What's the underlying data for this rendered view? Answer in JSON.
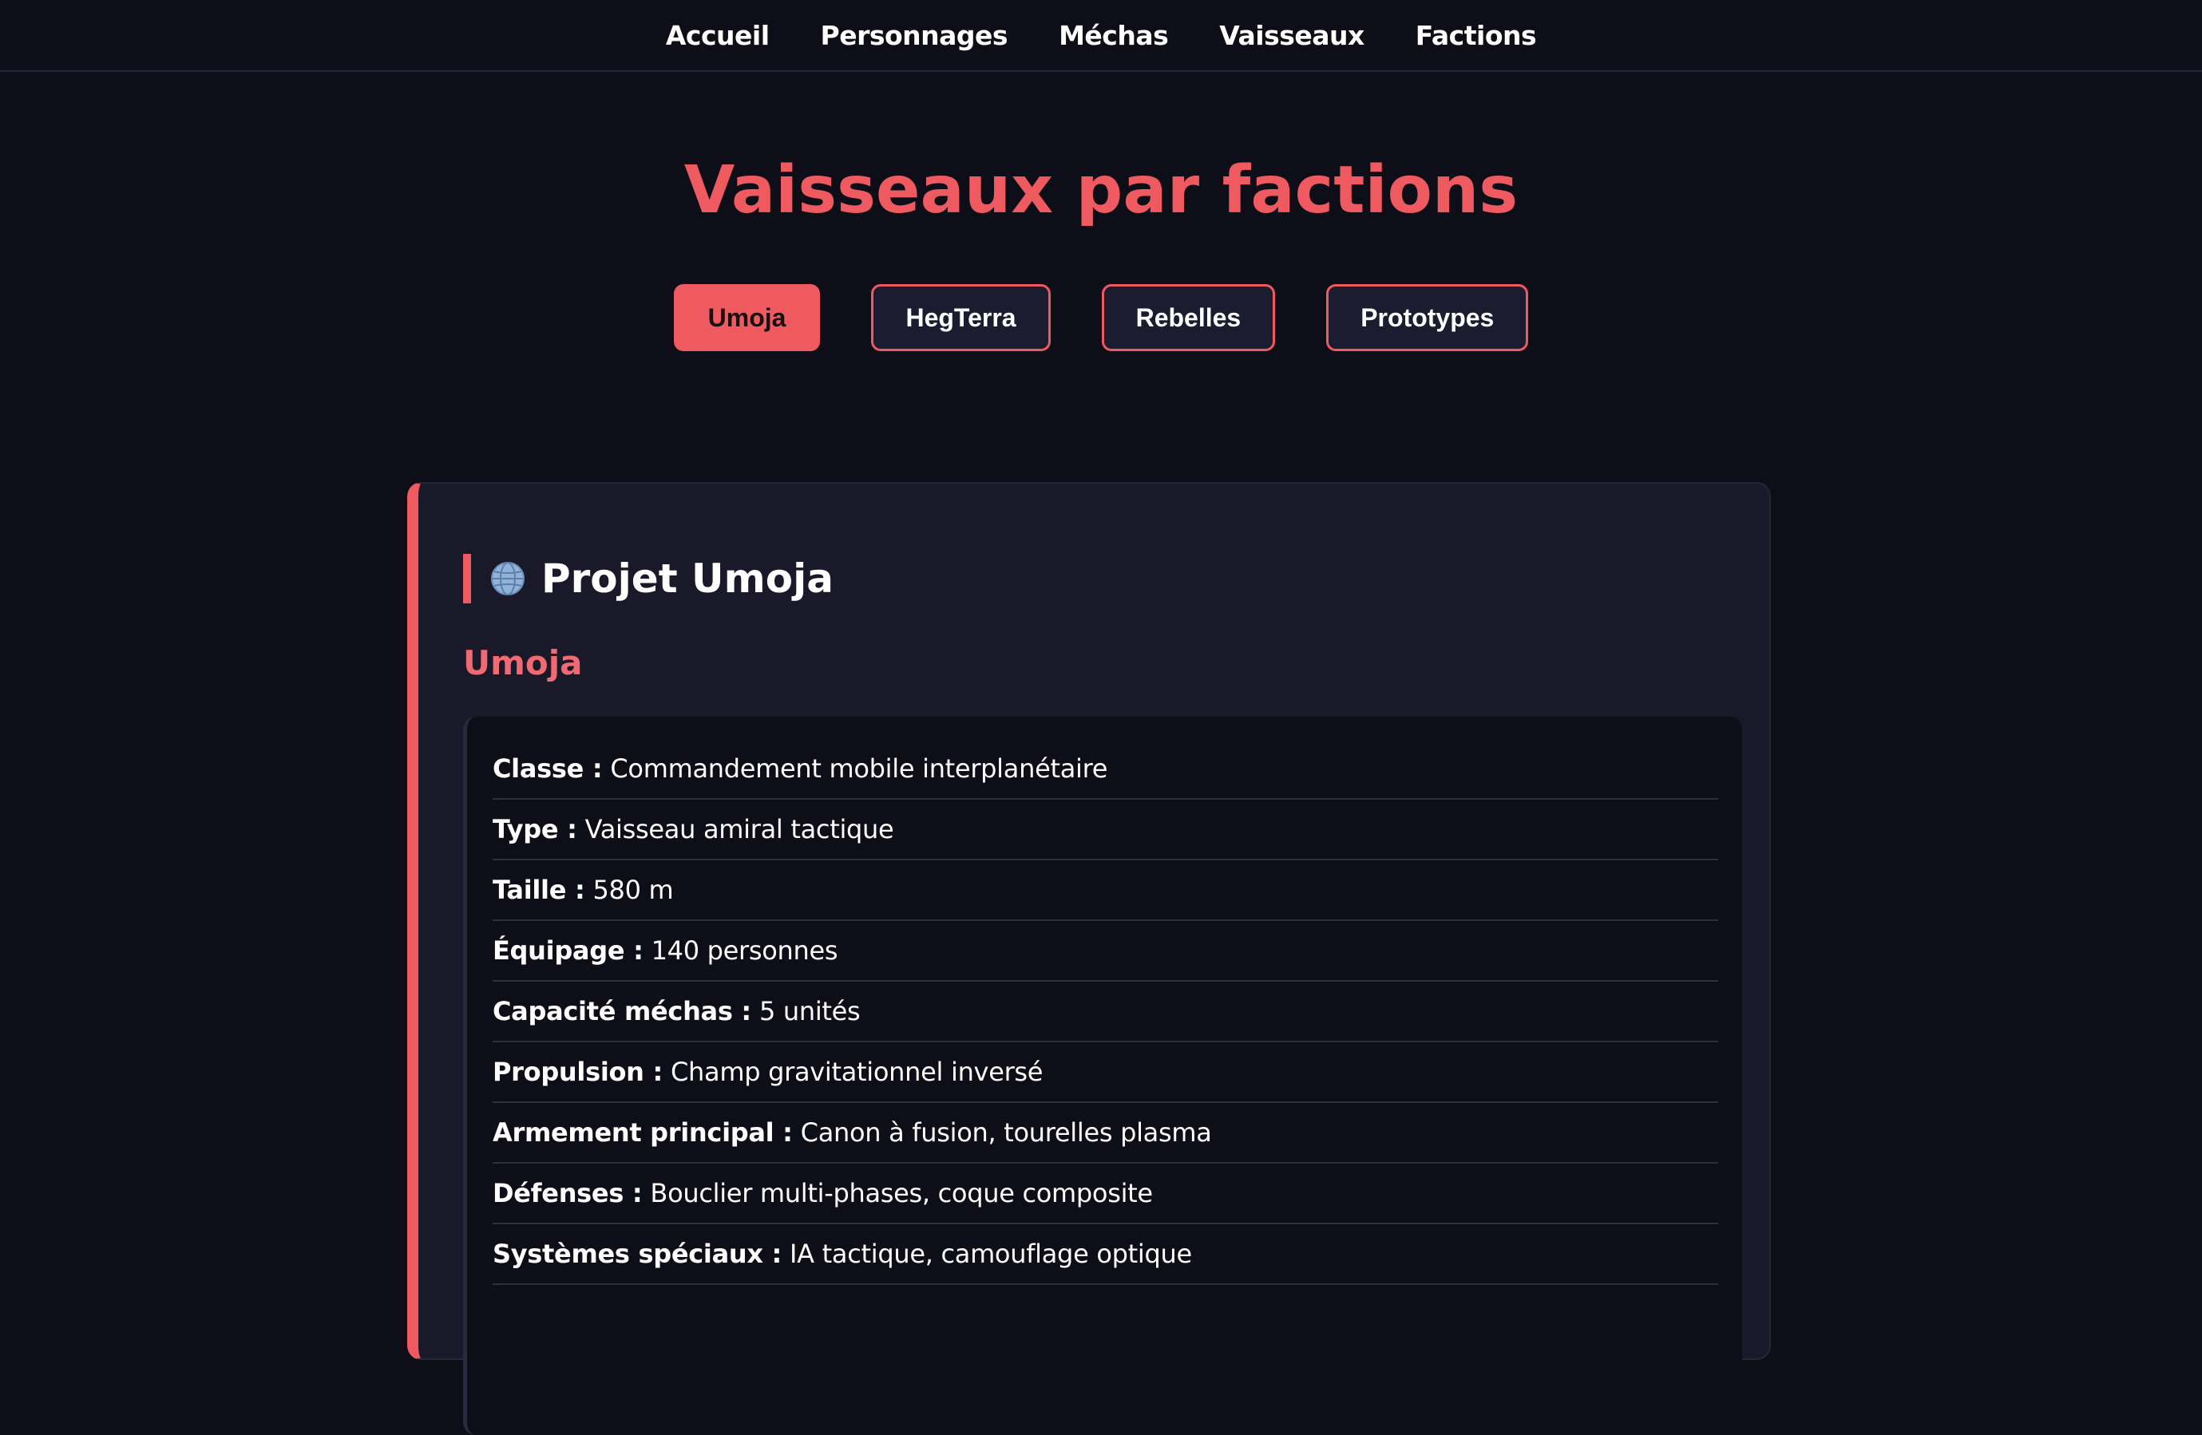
{
  "nav": {
    "items": [
      "Accueil",
      "Personnages",
      "Méchas",
      "Vaisseaux",
      "Factions"
    ]
  },
  "page": {
    "title": "Vaisseaux par factions"
  },
  "tabs": [
    {
      "label": "Umoja",
      "active": true
    },
    {
      "label": "HegTerra",
      "active": false
    },
    {
      "label": "Rebelles",
      "active": false
    },
    {
      "label": "Prototypes",
      "active": false
    }
  ],
  "faction": {
    "icon": "globe-icon",
    "title": "Projet Umoja",
    "ship_name": "Umoja",
    "specs": [
      {
        "label": "Classe :",
        "value": "Commandement mobile interplanétaire"
      },
      {
        "label": "Type :",
        "value": "Vaisseau amiral tactique"
      },
      {
        "label": "Taille :",
        "value": "580 m"
      },
      {
        "label": "Équipage :",
        "value": "140 personnes"
      },
      {
        "label": "Capacité méchas :",
        "value": "5 unités"
      },
      {
        "label": "Propulsion :",
        "value": "Champ gravitationnel inversé"
      },
      {
        "label": "Armement principal :",
        "value": "Canon à fusion, tourelles plasma"
      },
      {
        "label": "Défenses :",
        "value": "Bouclier multi-phases, coque composite"
      },
      {
        "label": "Systèmes spéciaux :",
        "value": "IA tactique, camouflage optique"
      }
    ]
  },
  "colors": {
    "accent": "#ef5a61",
    "background": "#0e0e18",
    "card": "#191929"
  }
}
